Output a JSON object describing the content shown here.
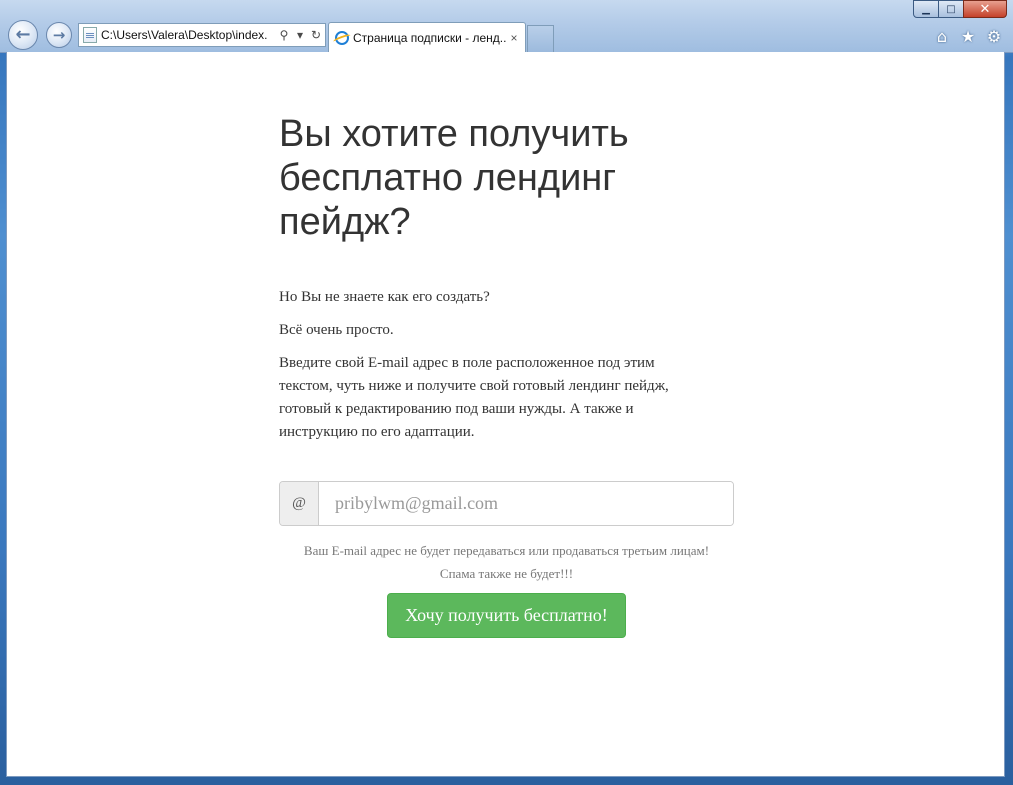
{
  "browser": {
    "address_url": "C:\\Users\\Valera\\Desktop\\index.",
    "tab_title": "Страница подписки - ленд...",
    "tab_close": "×",
    "back_icon": "←",
    "forward_icon": "→",
    "search_icon": "⚲",
    "dropdown_icon": "▾",
    "refresh_icon": "↻",
    "home_icon": "⌂",
    "favorites_icon": "★",
    "tools_icon": "⚙",
    "minimize": "▁",
    "maximize": "□",
    "close": "✕"
  },
  "page": {
    "headline": "Вы хотите получить бесплатно лендинг пейдж?",
    "paragraphs": [
      "Но Вы не знаете как его создать?",
      "Всё очень просто.",
      "Введите свой E-mail адрес в поле расположенное под этим текстом, чуть ниже и получите свой готовый лендинг пейдж, готовый к редактированию под ваши нужды. А также и инструкцию по его адаптации."
    ],
    "email_addon": "@",
    "email_placeholder": "pribylwm@gmail.com",
    "privacy_line1": "Ваш E-mail адрес не будет передаваться или продаваться третьим лицам!",
    "privacy_line2": "Спама также не будет!!!",
    "submit_label": "Хочу получить бесплатно!"
  },
  "colors": {
    "button_green": "#5cb85c",
    "text_dark": "#333333",
    "muted": "#777777"
  }
}
